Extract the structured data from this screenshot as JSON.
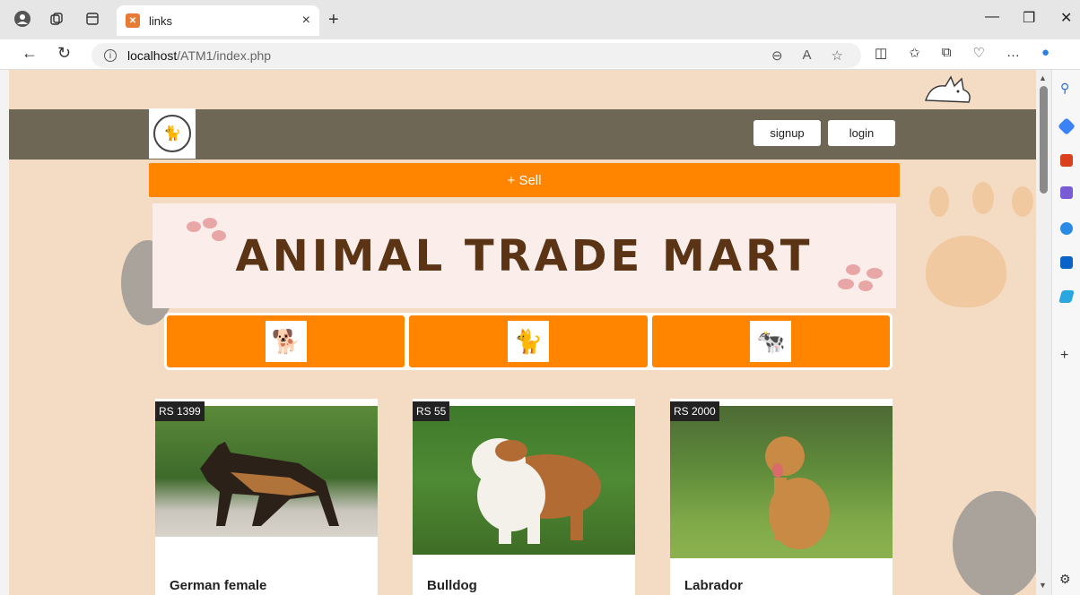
{
  "browser": {
    "tab_title": "links",
    "tab_close": "×",
    "new_tab": "+",
    "url_host": "localhost",
    "url_path": "/ATM1/index.php",
    "info_icon": "i",
    "window_controls": [
      "—",
      "❐",
      "✕"
    ],
    "toolbar_icons": [
      "zoom-icon",
      "read-aloud-icon",
      "favorite-star-icon",
      "split-screen-icon",
      "favorites-icon",
      "collections-icon",
      "browser-essentials-icon",
      "more-icon",
      "copilot-icon"
    ],
    "sidebar_icons": [
      "search-icon",
      "shopping-icon",
      "tools-icon",
      "games-icon",
      "microsoft365-icon",
      "outlook-icon",
      "send-icon",
      "add-icon",
      "settings-icon"
    ]
  },
  "site": {
    "nav": {
      "signup": "signup",
      "login": "login"
    },
    "sell_label": "+ Sell",
    "banner_title": "ANIMAL TRADE MART",
    "categories": [
      {
        "name": "dog",
        "icon": "dog-icon",
        "glyph": "🐕"
      },
      {
        "name": "cat",
        "icon": "cat-icon",
        "glyph": "🐈"
      },
      {
        "name": "cow",
        "icon": "cow-icon",
        "glyph": "🐄"
      }
    ],
    "listings": [
      {
        "price": "RS 1399",
        "title": "German female",
        "image": "german-shepherd-photo"
      },
      {
        "price": "RS 55",
        "title": "Bulldog",
        "image": "bulldog-photo"
      },
      {
        "price": "RS 2000",
        "title": "Labrador",
        "image": "labrador-photo"
      }
    ]
  },
  "colors": {
    "page_bg": "#f4dcc4",
    "navbar": "#6e6755",
    "accent_orange": "#ff8400",
    "banner_text": "#5b3415"
  }
}
